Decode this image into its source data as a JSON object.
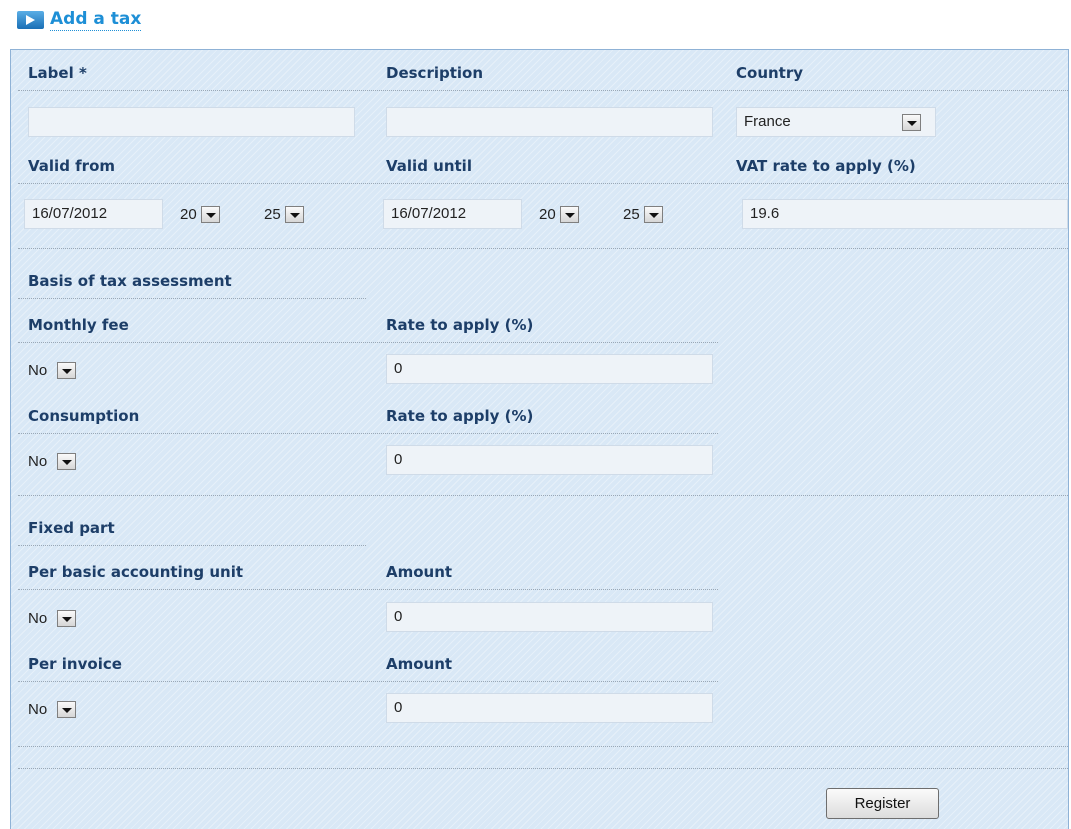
{
  "page_title": "Add a tax",
  "icons": {
    "title": "arrow-right-icon",
    "dropdown": "chevron-down-icon"
  },
  "colors": {
    "panel_bg": "#d9e8f6",
    "title": "#1e8fd6",
    "label": "#1d3e68"
  },
  "form": {
    "label": {
      "label": "Label *",
      "value": ""
    },
    "description": {
      "label": "Description",
      "value": ""
    },
    "country": {
      "label": "Country",
      "value": "France"
    },
    "valid_from": {
      "label": "Valid from",
      "date": "16/07/2012",
      "hour": "20",
      "minute": "25"
    },
    "valid_until": {
      "label": "Valid until",
      "date": "16/07/2012",
      "hour": "20",
      "minute": "25"
    },
    "vat_rate": {
      "label": "VAT rate to apply (%)",
      "value": "19.6"
    },
    "basis_section": "Basis of tax assessment",
    "monthly_fee": {
      "label": "Monthly fee",
      "value": "No",
      "rate_label": "Rate to apply (%)",
      "rate_value": "0"
    },
    "consumption": {
      "label": "Consumption",
      "value": "No",
      "rate_label": "Rate to apply (%)",
      "rate_value": "0"
    },
    "fixed_section": "Fixed part",
    "per_unit": {
      "label": "Per basic accounting unit",
      "value": "No",
      "amount_label": "Amount",
      "amount_value": "0"
    },
    "per_invoice": {
      "label": "Per invoice",
      "value": "No",
      "amount_label": "Amount",
      "amount_value": "0"
    }
  },
  "register_button": "Register"
}
